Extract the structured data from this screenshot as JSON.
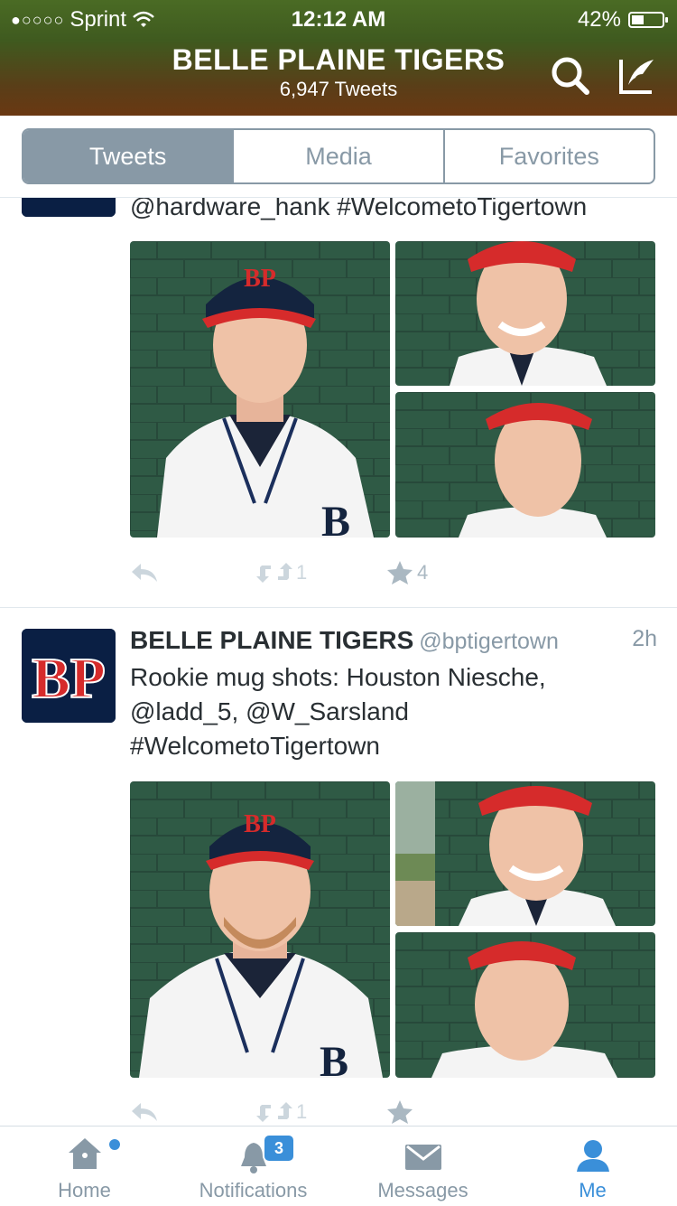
{
  "status_bar": {
    "signal_dots": "●○○○○",
    "carrier": "Sprint",
    "time": "12:12 AM",
    "battery": "42%",
    "battery_level": 0.42
  },
  "header": {
    "title": "BELLE PLAINE TIGERS",
    "subtitle": "6,947 Tweets"
  },
  "tabs": [
    {
      "label": "Tweets",
      "active": true
    },
    {
      "label": "Media",
      "active": false
    },
    {
      "label": "Favorites",
      "active": false
    }
  ],
  "tweets": [
    {
      "text_tail": "@hardware_hank #WelcometoTigertown",
      "retweets": "1",
      "favorites": "4"
    },
    {
      "author": "BELLE PLAINE TIGERS",
      "handle": "@bptigertown",
      "time": "2h",
      "text": "Rookie mug shots: Houston Niesche, @ladd_5, @W_Sarsland #WelcometoTigertown",
      "retweets": "1",
      "favorites": ""
    }
  ],
  "avatar_logo": "BP",
  "cap_logo": "BP",
  "jersey_letter": "B",
  "bottom_nav": {
    "home": "Home",
    "notifications": "Notifications",
    "notifications_badge": "3",
    "messages": "Messages",
    "me": "Me"
  },
  "colors": {
    "accent": "#3a8fd9",
    "tab_gray": "#8899a6",
    "wall_green": "#2f5a45",
    "cap_red": "#d62b2b",
    "cap_navy": "#14243f"
  }
}
